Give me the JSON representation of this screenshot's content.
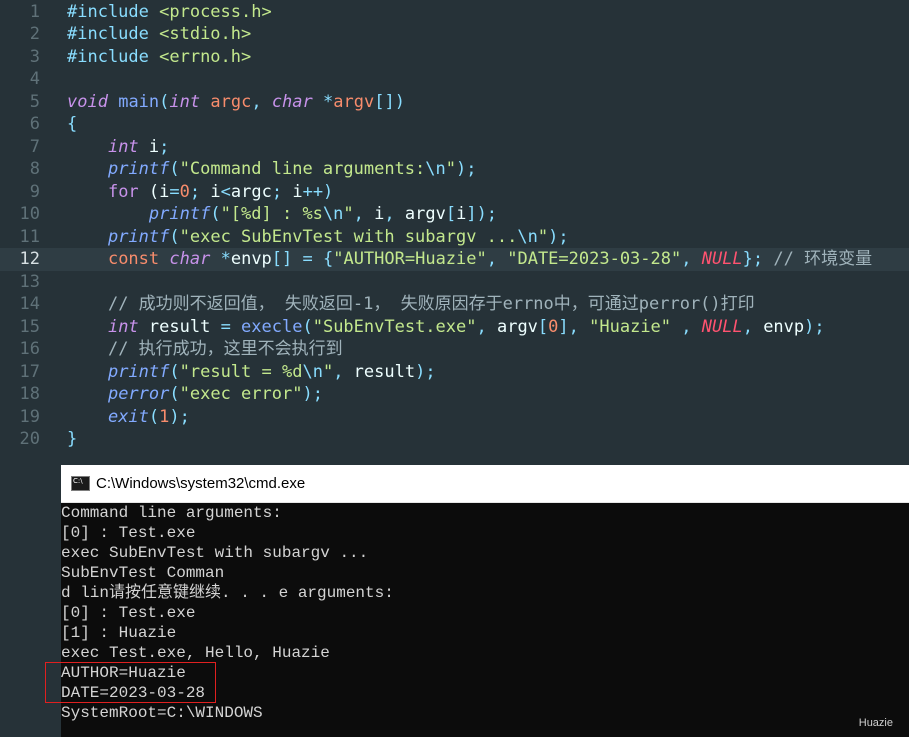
{
  "editor": {
    "current_line": 12,
    "lines": [
      {
        "num": "1",
        "tokens": [
          [
            "pp",
            "#include "
          ],
          [
            "inc",
            "<process.h>"
          ]
        ]
      },
      {
        "num": "2",
        "tokens": [
          [
            "pp",
            "#include "
          ],
          [
            "inc",
            "<stdio.h>"
          ]
        ]
      },
      {
        "num": "3",
        "tokens": [
          [
            "pp",
            "#include "
          ],
          [
            "inc",
            "<errno.h>"
          ]
        ]
      },
      {
        "num": "4",
        "tokens": []
      },
      {
        "num": "5",
        "tokens": [
          [
            "type",
            "void"
          ],
          [
            "var",
            " "
          ],
          [
            "fn2",
            "main"
          ],
          [
            "punc",
            "("
          ],
          [
            "type",
            "int"
          ],
          [
            "var",
            " "
          ],
          [
            "param",
            "argc"
          ],
          [
            "punc",
            ", "
          ],
          [
            "type",
            "char"
          ],
          [
            "var",
            " "
          ],
          [
            "punc",
            "*"
          ],
          [
            "param",
            "argv"
          ],
          [
            "punc",
            "[])"
          ]
        ]
      },
      {
        "num": "6",
        "tokens": [
          [
            "punc",
            "{"
          ]
        ]
      },
      {
        "num": "7",
        "tokens": [
          [
            "var",
            "    "
          ],
          [
            "type",
            "int"
          ],
          [
            "var",
            " i"
          ],
          [
            "punc",
            ";"
          ]
        ]
      },
      {
        "num": "8",
        "tokens": [
          [
            "var",
            "    "
          ],
          [
            "fn",
            "printf"
          ],
          [
            "punc",
            "("
          ],
          [
            "str",
            "\"Command line arguments:"
          ],
          [
            "esc",
            "\\n"
          ],
          [
            "str",
            "\""
          ],
          [
            "punc",
            ");"
          ]
        ]
      },
      {
        "num": "9",
        "tokens": [
          [
            "var",
            "    "
          ],
          [
            "kw",
            "for"
          ],
          [
            "var",
            " ("
          ],
          [
            "var",
            "i"
          ],
          [
            "punc",
            "="
          ],
          [
            "num",
            "0"
          ],
          [
            "punc",
            "; "
          ],
          [
            "var",
            "i"
          ],
          [
            "punc",
            "<"
          ],
          [
            "var",
            "argc"
          ],
          [
            "punc",
            "; "
          ],
          [
            "var",
            "i"
          ],
          [
            "punc",
            "++)"
          ]
        ]
      },
      {
        "num": "10",
        "tokens": [
          [
            "var",
            "        "
          ],
          [
            "fn",
            "printf"
          ],
          [
            "punc",
            "("
          ],
          [
            "str",
            "\"[%d] : %s"
          ],
          [
            "esc",
            "\\n"
          ],
          [
            "str",
            "\""
          ],
          [
            "punc",
            ", "
          ],
          [
            "var",
            "i"
          ],
          [
            "punc",
            ", "
          ],
          [
            "var",
            "argv"
          ],
          [
            "punc",
            "["
          ],
          [
            "var",
            "i"
          ],
          [
            "punc",
            "]);"
          ]
        ]
      },
      {
        "num": "11",
        "tokens": [
          [
            "var",
            "    "
          ],
          [
            "fn",
            "printf"
          ],
          [
            "punc",
            "("
          ],
          [
            "str",
            "\"exec SubEnvTest with subargv ..."
          ],
          [
            "esc",
            "\\n"
          ],
          [
            "str",
            "\""
          ],
          [
            "punc",
            ");"
          ]
        ]
      },
      {
        "num": "12",
        "tokens": [
          [
            "var",
            "    "
          ],
          [
            "num",
            "const"
          ],
          [
            "var",
            " "
          ],
          [
            "type",
            "char"
          ],
          [
            "var",
            " "
          ],
          [
            "punc",
            "*"
          ],
          [
            "var",
            "envp"
          ],
          [
            "punc",
            "[] = {"
          ],
          [
            "str",
            "\"AUTHOR=Huazie\""
          ],
          [
            "punc",
            ", "
          ],
          [
            "str",
            "\"DATE=2023-03-28\""
          ],
          [
            "punc",
            ", "
          ],
          [
            "null",
            "NULL"
          ],
          [
            "punc",
            "}; "
          ],
          [
            "cmt",
            "// 环境变量"
          ]
        ]
      },
      {
        "num": "13",
        "tokens": []
      },
      {
        "num": "14",
        "tokens": [
          [
            "var",
            "    "
          ],
          [
            "cmt",
            "// 成功则不返回值， 失败返回-1， 失败原因存于errno中，可通过perror()打印"
          ]
        ]
      },
      {
        "num": "15",
        "tokens": [
          [
            "var",
            "    "
          ],
          [
            "type",
            "int"
          ],
          [
            "var",
            " result "
          ],
          [
            "punc",
            "= "
          ],
          [
            "fn2",
            "execle"
          ],
          [
            "punc",
            "("
          ],
          [
            "str",
            "\"SubEnvTest.exe\""
          ],
          [
            "punc",
            ", "
          ],
          [
            "var",
            "argv"
          ],
          [
            "punc",
            "["
          ],
          [
            "num",
            "0"
          ],
          [
            "punc",
            "], "
          ],
          [
            "str",
            "\"Huazie\""
          ],
          [
            "punc",
            " , "
          ],
          [
            "null",
            "NULL"
          ],
          [
            "punc",
            ", "
          ],
          [
            "var",
            "envp"
          ],
          [
            "punc",
            ");"
          ]
        ]
      },
      {
        "num": "16",
        "tokens": [
          [
            "var",
            "    "
          ],
          [
            "cmt",
            "// 执行成功，这里不会执行到"
          ]
        ]
      },
      {
        "num": "17",
        "tokens": [
          [
            "var",
            "    "
          ],
          [
            "fn",
            "printf"
          ],
          [
            "punc",
            "("
          ],
          [
            "str",
            "\"result = %d"
          ],
          [
            "esc",
            "\\n"
          ],
          [
            "str",
            "\""
          ],
          [
            "punc",
            ", "
          ],
          [
            "var",
            "result"
          ],
          [
            "punc",
            ");"
          ]
        ]
      },
      {
        "num": "18",
        "tokens": [
          [
            "var",
            "    "
          ],
          [
            "fn",
            "perror"
          ],
          [
            "punc",
            "("
          ],
          [
            "str",
            "\"exec error\""
          ],
          [
            "punc",
            ");"
          ]
        ]
      },
      {
        "num": "19",
        "tokens": [
          [
            "var",
            "    "
          ],
          [
            "fn",
            "exit"
          ],
          [
            "punc",
            "("
          ],
          [
            "num",
            "1"
          ],
          [
            "punc",
            ");"
          ]
        ]
      },
      {
        "num": "20",
        "tokens": [
          [
            "punc",
            "}"
          ]
        ]
      }
    ]
  },
  "cmd_window": {
    "icon_text": "C:\\",
    "title": "C:\\Windows\\system32\\cmd.exe",
    "output": [
      "Command line arguments:",
      "[0] : Test.exe",
      "exec SubEnvTest with subargv ...",
      "SubEnvTest Comman",
      "d lin请按任意键继续. . . e arguments:",
      "[0] : Test.exe",
      "[1] : Huazie",
      "exec Test.exe, Hello, Huazie",
      "AUTHOR=Huazie",
      "DATE=2023-03-28",
      "SystemRoot=C:\\WINDOWS"
    ]
  },
  "watermark": "Huazie",
  "colors": {
    "editor_bg": "#263238",
    "keyword": "#c792ea",
    "function": "#82aaff",
    "string": "#c3e88d",
    "number": "#f78c6c",
    "null": "#ff5370",
    "highlight_box": "#e02020",
    "console_bg": "#0c0c0c"
  }
}
